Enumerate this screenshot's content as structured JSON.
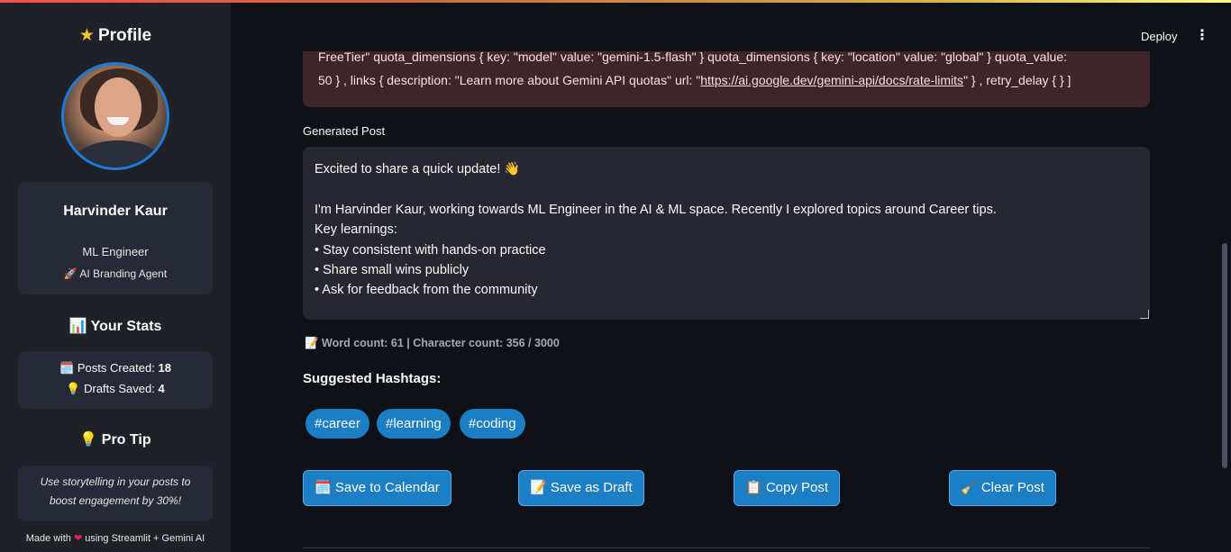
{
  "sidebar": {
    "title": "Profile",
    "title_icon": "star-icon",
    "profile": {
      "name": "Harvinder Kaur",
      "role": "ML Engineer",
      "agent_label": "🚀 AI Branding Agent"
    },
    "stats_heading": "📊 Your Stats",
    "stats": {
      "posts_label": "🗓️ Posts Created: ",
      "posts_value": "18",
      "drafts_label": "💡 Drafts Saved: ",
      "drafts_value": "4"
    },
    "tip_heading": "💡 Pro Tip",
    "tip_line1": "Use storytelling in your posts to",
    "tip_line2": "boost engagement by 30%!",
    "made_with_prefix": "Made with ",
    "made_with_suffix": " using Streamlit + Gemini AI"
  },
  "header": {
    "deploy_label": "Deploy",
    "menu_icon": "more-vertical-icon"
  },
  "error": {
    "line_partial": "FreeTier\" quota_dimensions { key: \"model\" value: \"gemini-1.5-flash\" } quota_dimensions { key: \"location\" value: \"global\" } quota_value:",
    "line_start": "50 } , links { description: \"Learn more about Gemini API quotas\" url: \"",
    "link": "https://ai.google.dev/gemini-api/docs/rate-limits",
    "line_end": "\" } , retry_delay { } ]"
  },
  "post": {
    "label": "Generated Post",
    "text": "Excited to share a quick update! 👋\n\nI'm Harvinder Kaur, working towards ML Engineer in the AI & ML space. Recently I explored topics around Career tips.\nKey learnings:\n• Stay consistent with hands-on practice\n• Share small wins publicly\n• Ask for feedback from the community",
    "counts": "📝 Word count: 61 | Character count: 356 / 3000"
  },
  "hashtags": {
    "title": "Suggested Hashtags:",
    "tags": [
      "#career",
      "#learning",
      "#coding"
    ]
  },
  "actions": {
    "calendar": "🗓️ Save to Calendar",
    "draft": "📝 Save as Draft",
    "copy": "📋 Copy Post",
    "clear": "🧹 Clear Post"
  },
  "colors": {
    "accent": "#1c7ec4",
    "sidebar_bg": "#1f2129",
    "main_bg": "#0e1117",
    "error_bg": "#3e2529"
  }
}
